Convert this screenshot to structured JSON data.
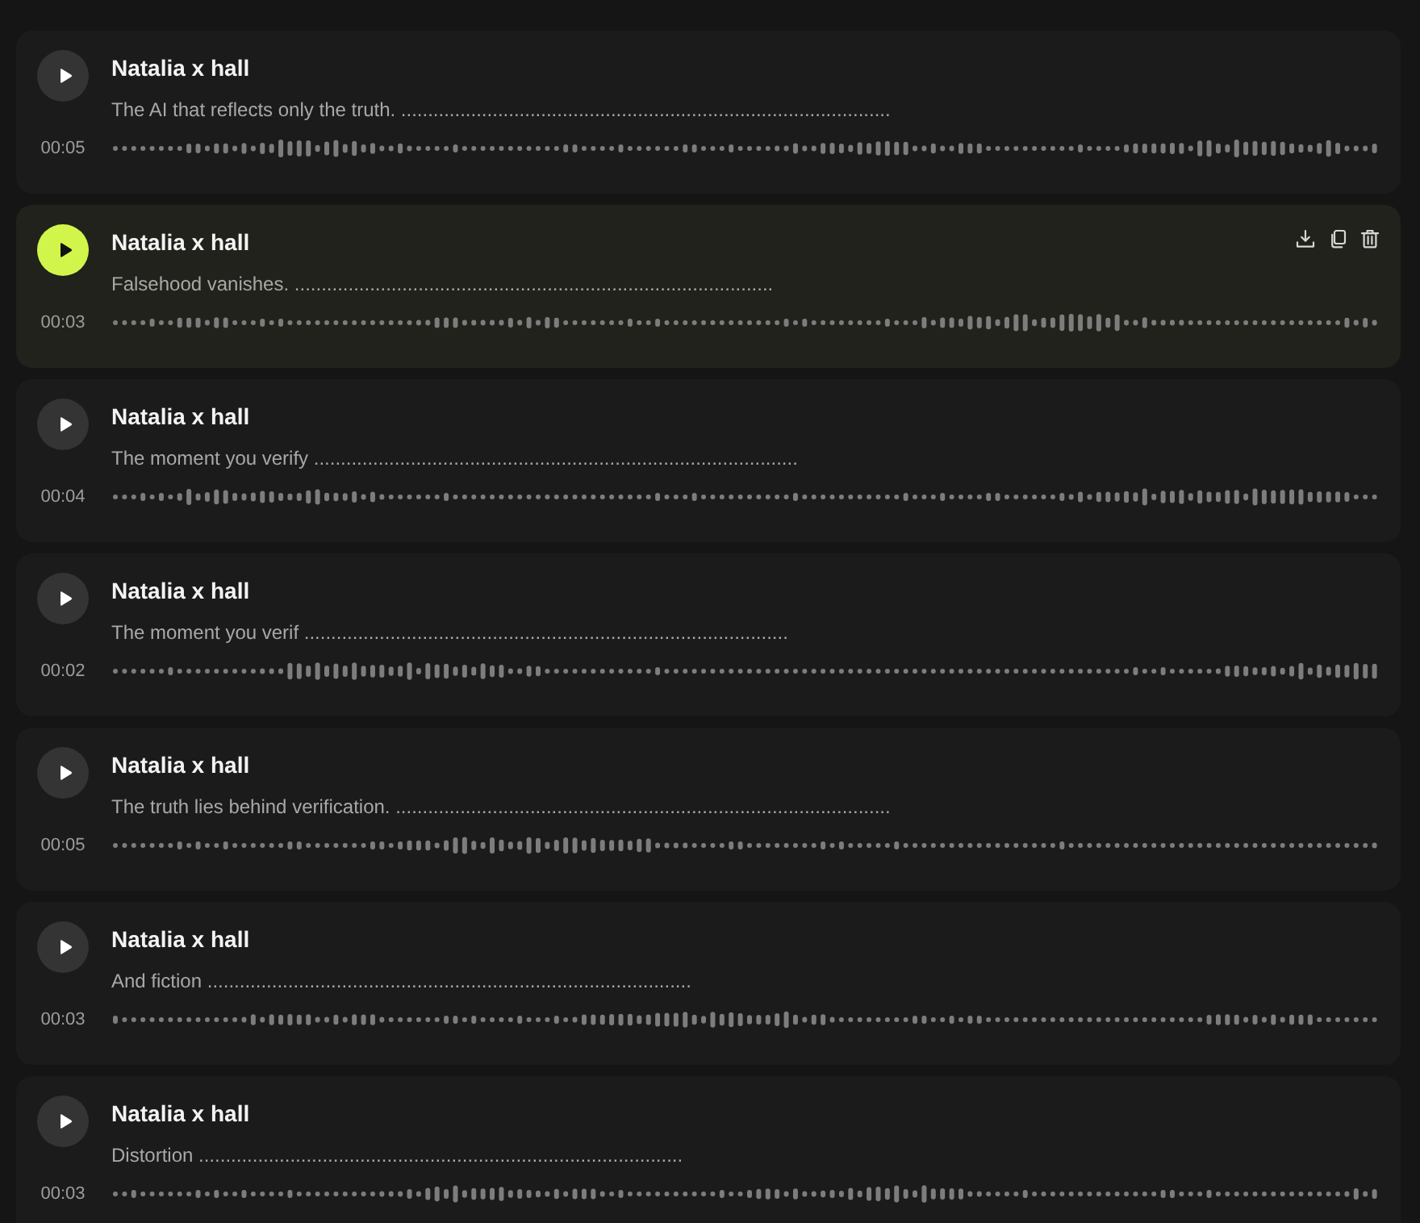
{
  "tracks": [
    {
      "title": "Natalia x hall",
      "text": "The AI that reflects only the truth. ...........................................................................................",
      "duration": "00:05",
      "selected": false
    },
    {
      "title": "Natalia x hall",
      "text": "Falsehood vanishes. .........................................................................................",
      "duration": "00:03",
      "selected": true
    },
    {
      "title": "Natalia x hall",
      "text": "The moment you verify ..........................................................................................",
      "duration": "00:04",
      "selected": false
    },
    {
      "title": "Natalia x hall",
      "text": "The moment you verif ..........................................................................................",
      "duration": "00:02",
      "selected": false
    },
    {
      "title": "Natalia x hall",
      "text": "The truth lies behind verification. ............................................................................................",
      "duration": "00:05",
      "selected": false
    },
    {
      "title": "Natalia x hall",
      "text": "And fiction ..........................................................................................",
      "duration": "00:03",
      "selected": false
    },
    {
      "title": "Natalia x hall",
      "text": "Distortion ..........................................................................................",
      "duration": "00:03",
      "selected": false
    }
  ]
}
